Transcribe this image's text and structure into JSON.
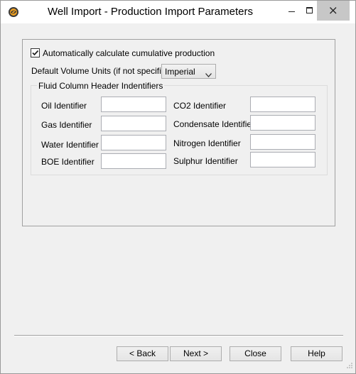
{
  "window": {
    "title": "Well Import - Production Import Parameters",
    "app_icon": "swirl-logo-icon",
    "controls": [
      "minimize-icon",
      "maximize-icon",
      "close-icon"
    ]
  },
  "options": {
    "auto_cumulative_label": "Automatically calculate cumulative production",
    "auto_cumulative_checked": true,
    "default_units_label": "Default Volume Units (if not specified)",
    "default_units_value": "Imperial"
  },
  "identifiers": {
    "group_title": "Fluid Column Header Indentifiers",
    "oil": {
      "label": "Oil Identifier",
      "value": ""
    },
    "gas": {
      "label": "Gas Identifier",
      "value": ""
    },
    "water": {
      "label": "Water Identifier",
      "value": ""
    },
    "boe": {
      "label": "BOE Identifier",
      "value": ""
    },
    "co2": {
      "label": "CO2 Identifier",
      "value": ""
    },
    "condensate": {
      "label": "Condensate Identifier",
      "value": ""
    },
    "nitrogen": {
      "label": "Nitrogen Identifier",
      "value": ""
    },
    "sulphur": {
      "label": "Sulphur Identifier",
      "value": ""
    }
  },
  "footer": {
    "back_label": "< Back",
    "next_label": "Next >",
    "close_label": "Close",
    "help_label": "Help"
  }
}
